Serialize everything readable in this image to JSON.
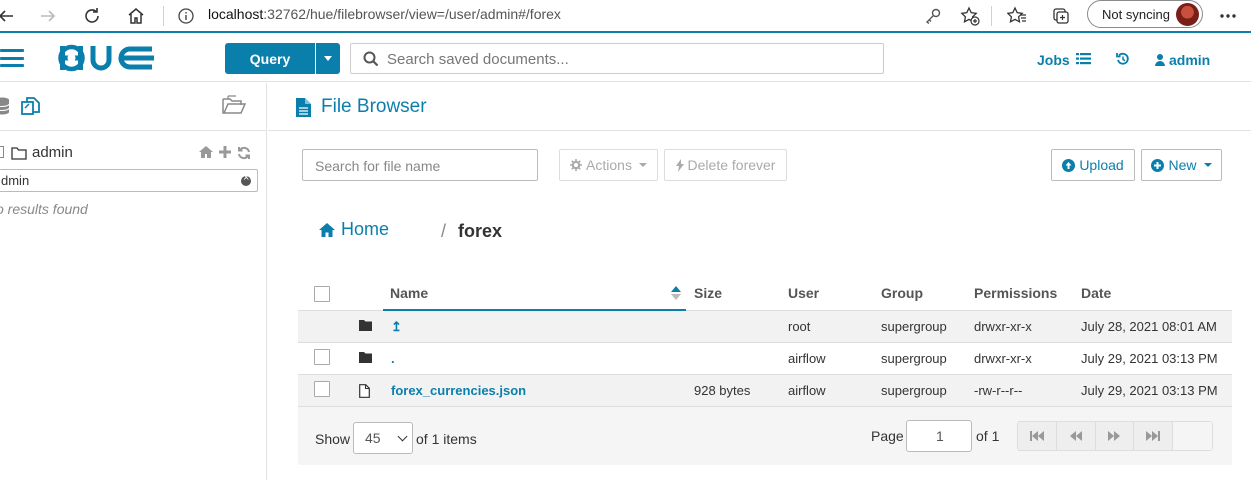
{
  "browser": {
    "url_host": "localhost",
    "url_rest": ":32762/hue/filebrowser/view=/user/admin#/forex",
    "sync_label": "Not syncing"
  },
  "topbar": {
    "query_label": "Query",
    "search_placeholder": "Search saved documents...",
    "jobs_label": "Jobs",
    "user_label": "admin"
  },
  "left_panel": {
    "root_label": "admin",
    "filter_value": "dmin",
    "no_results": "o results found"
  },
  "main": {
    "title": "File Browser",
    "search_placeholder": "Search for file name",
    "actions_label": "Actions",
    "delete_label": "Delete forever",
    "upload_label": "Upload",
    "new_label": "New",
    "breadcrumb_home": "Home",
    "breadcrumb_sep": "/",
    "breadcrumb_current": "forex"
  },
  "table": {
    "headers": {
      "name": "Name",
      "size": "Size",
      "user": "User",
      "group": "Group",
      "permissions": "Permissions",
      "date": "Date"
    },
    "rows": [
      {
        "name": "↥",
        "size": "",
        "user": "root",
        "group": "supergroup",
        "permissions": "drwxr-xr-x",
        "date": "July 28, 2021 08:01 AM",
        "icon": "folder-icon"
      },
      {
        "name": ".",
        "size": "",
        "user": "airflow",
        "group": "supergroup",
        "permissions": "drwxr-xr-x",
        "date": "July 29, 2021 03:13 PM",
        "icon": "folder-icon"
      },
      {
        "name": "forex_currencies.json",
        "size": "928 bytes",
        "user": "airflow",
        "group": "supergroup",
        "permissions": "-rw-r--r--",
        "date": "July 29, 2021 03:13 PM",
        "icon": "file-icon"
      }
    ]
  },
  "footer": {
    "show_label": "Show",
    "page_size": "45",
    "items_label": "of 1 items",
    "page_label": "Page",
    "page_value": "1",
    "of_pages": "of 1"
  },
  "colors": {
    "accent": "#0B7FAB"
  }
}
